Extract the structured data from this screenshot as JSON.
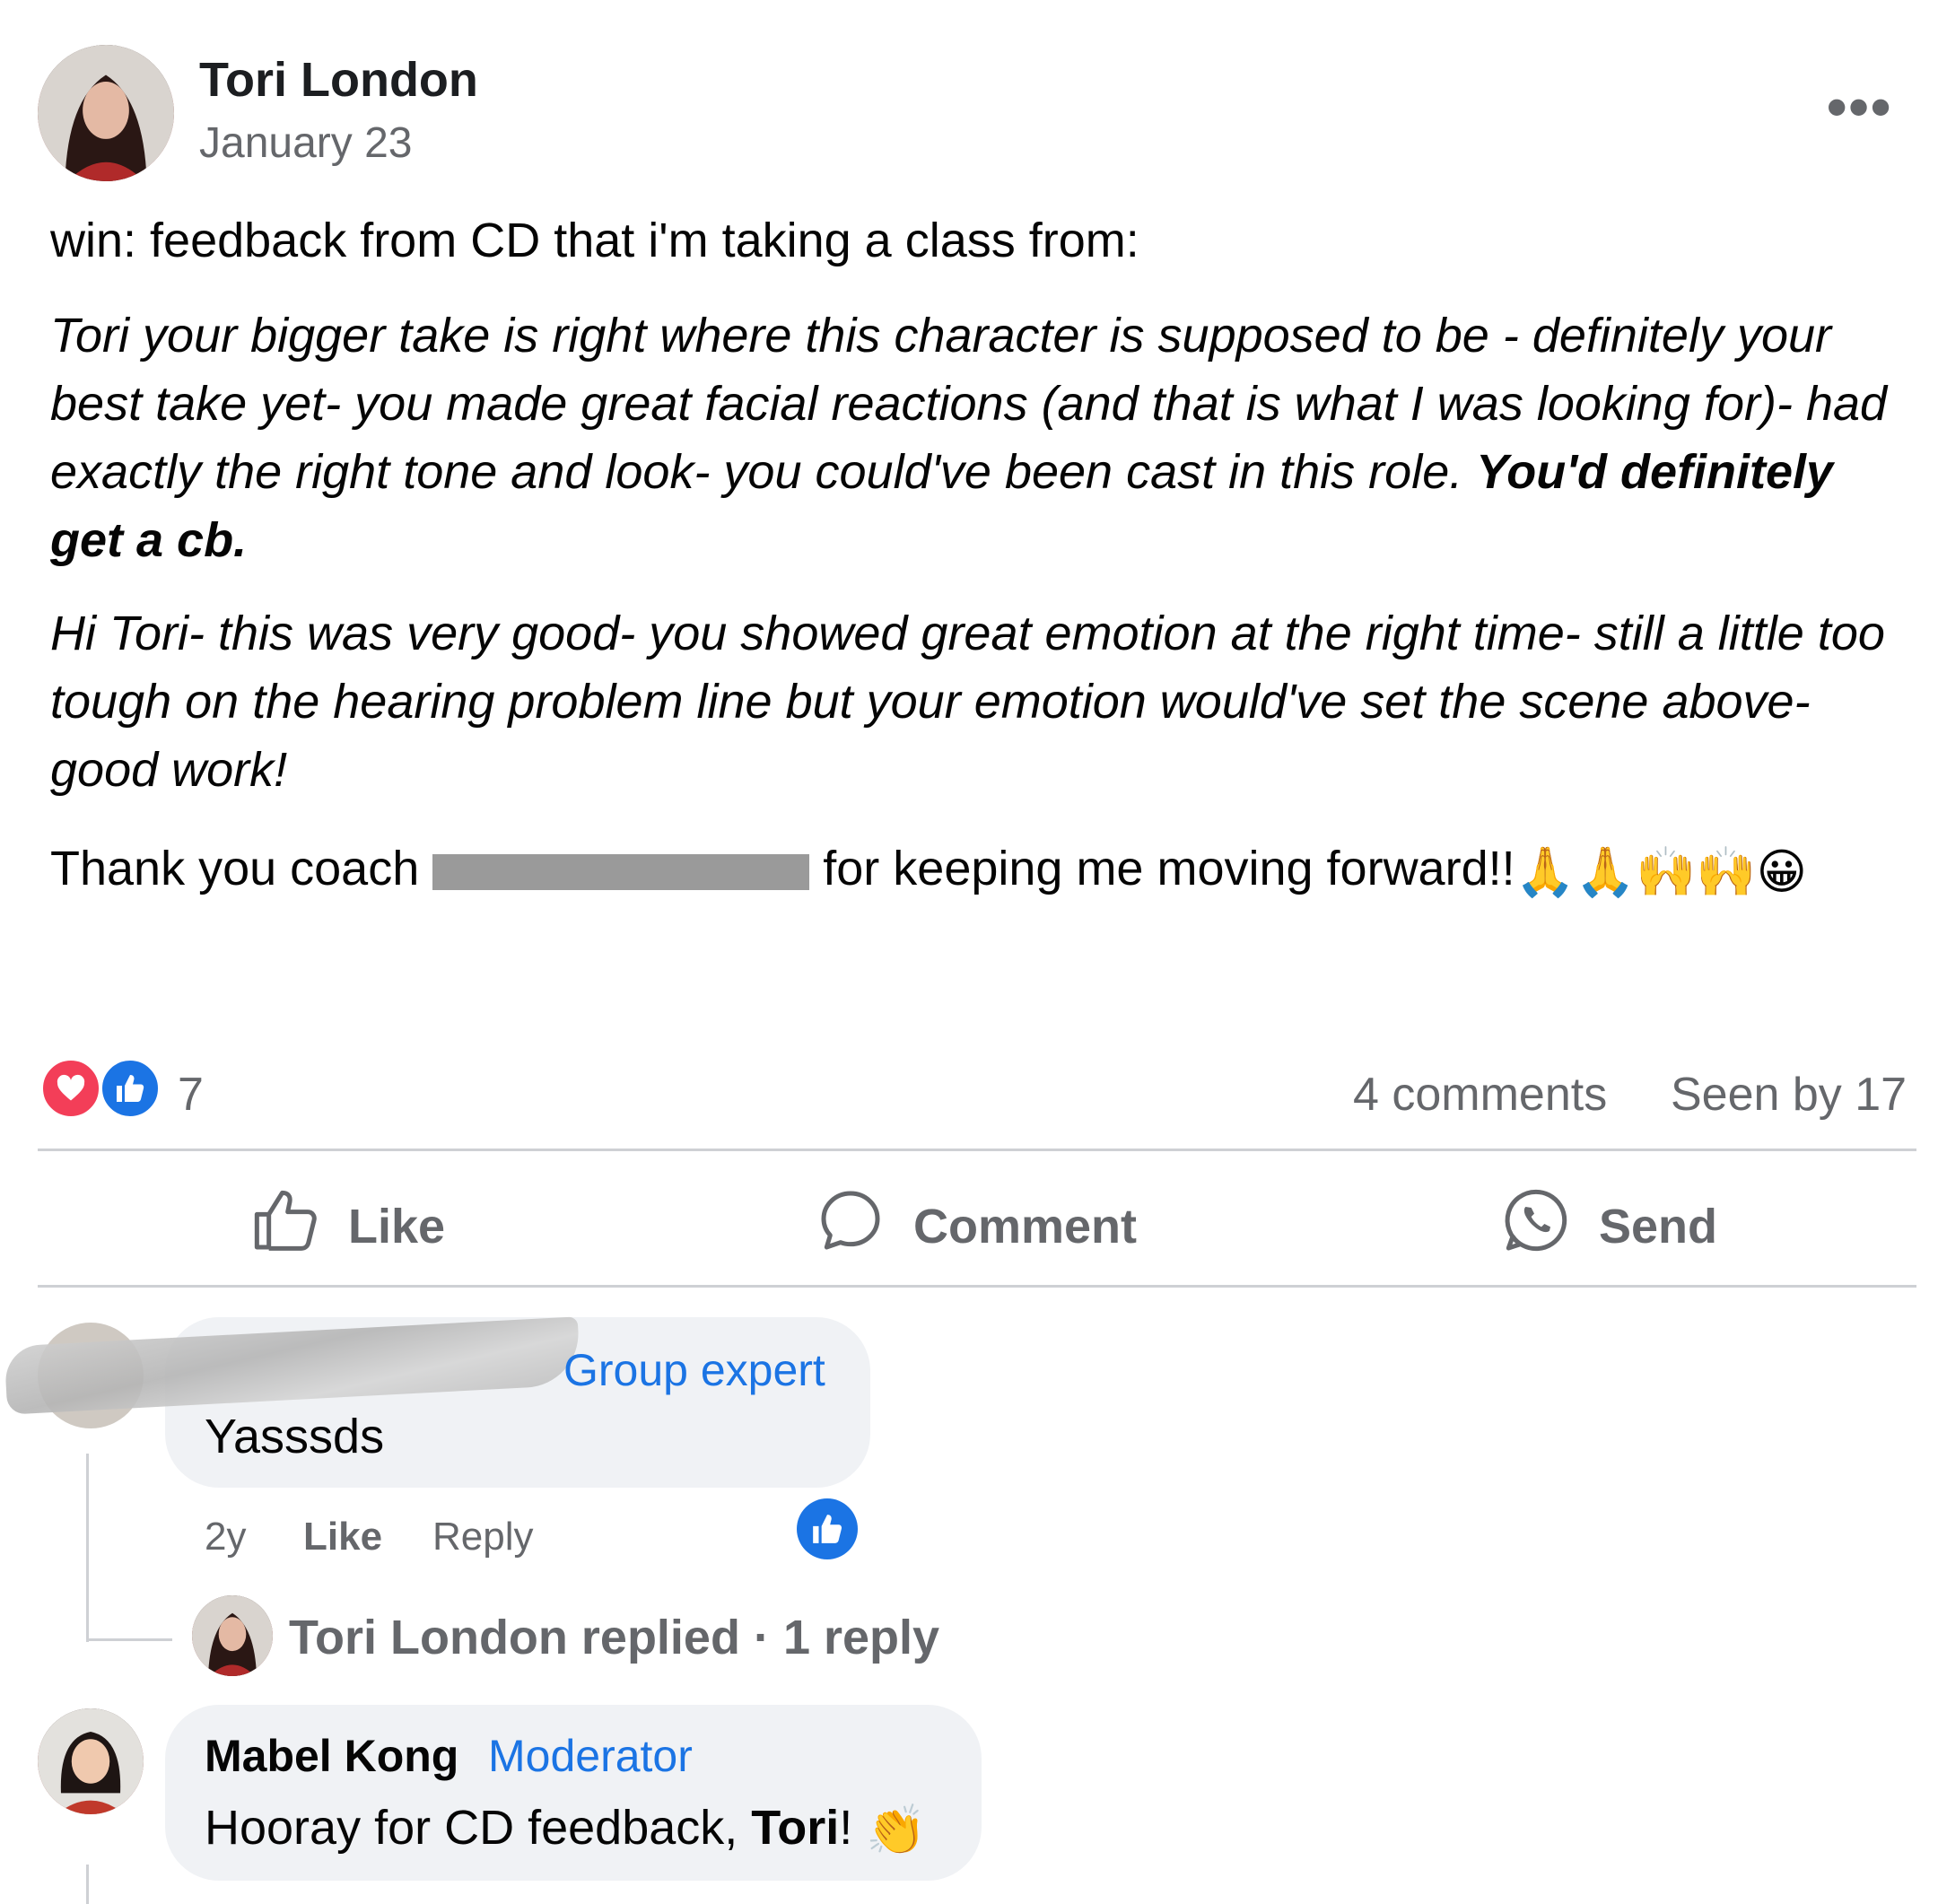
{
  "post": {
    "author": "Tori London",
    "date": "January 23",
    "more_label": "•••",
    "line1": "win: feedback from CD that i'm taking a class from:",
    "quote1_p1": "Tori your bigger take is right where this character is supposed to be - definitely your best take yet- you made great facial reactions (and that is what I was looking for)- had exactly the right tone and look- you could've been cast in this role. ",
    "quote1_bold": "You'd definitely get a cb.",
    "quote2": "Hi Tori- this was very good- you showed great emotion at the right time- still a little too tough on the hearing problem line but your emotion would've set the scene above- good work!",
    "thanks_before": "Thank you coach ",
    "thanks_after": " for keeping me moving forward!!",
    "thanks_emojis": "🙏🙏🙌🙌😀",
    "thanks_last_emoji": "😀"
  },
  "stats": {
    "reaction_count": "7",
    "comments": "4 comments",
    "seen_by": "Seen by 17"
  },
  "actions": {
    "like": "Like",
    "comment": "Comment",
    "send": "Send"
  },
  "comments": [
    {
      "badge": "Group expert",
      "text": "Yasssds",
      "time": "2y",
      "like": "Like",
      "reply": "Reply",
      "replied": "Tori London replied · 1 reply"
    },
    {
      "name": "Mabel Kong",
      "badge": "Moderator",
      "text_before": "Hooray for CD feedback, ",
      "text_bold": "Tori",
      "text_after": "! ",
      "emoji": "👏"
    }
  ],
  "colors": {
    "brand_blue": "#1b74e4",
    "love_red": "#f33e58",
    "gray_text": "#65676b"
  }
}
